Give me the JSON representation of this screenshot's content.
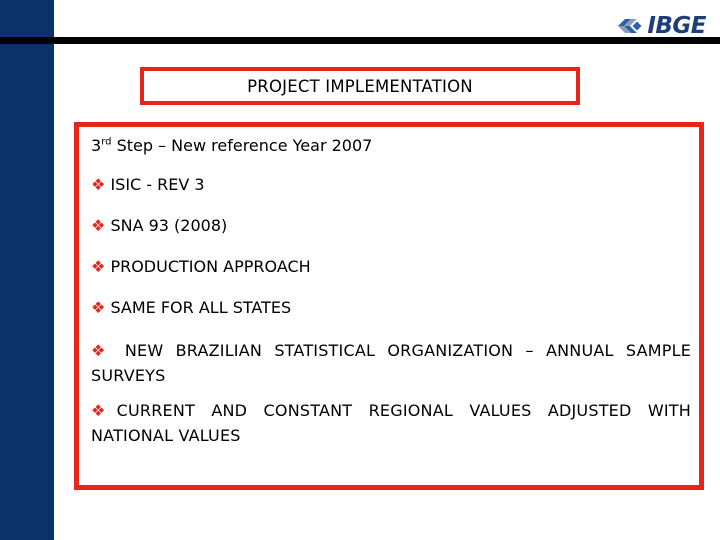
{
  "slide": {
    "logo": {
      "mark_name": "ibge-diamond-mark",
      "text": "IBGE",
      "brand_color": "#1b3f7a"
    },
    "colors": {
      "side_band": "#0c3268",
      "rule": "#000000",
      "box_border": "#e8251b",
      "bullet": "#e8251b",
      "text": "#000000"
    },
    "title": {
      "text": "PROJECT IMPLEMENTATION"
    },
    "content": {
      "heading": {
        "prefix": "3",
        "ordinal": "rd",
        "rest": " Step – New reference Year 2007"
      },
      "bullet_glyph": "❖",
      "items": [
        {
          "text": "ISIC - REV 3",
          "style": "single"
        },
        {
          "text": "SNA 93 (2008)",
          "style": "single"
        },
        {
          "text": "PRODUCTION APPROACH",
          "style": "single"
        },
        {
          "text": "SAME FOR ALL STATES",
          "style": "single"
        },
        {
          "text": "  NEW BRAZILIAN STATISTICAL ORGANIZATION – ANNUAL SAMPLE SURVEYS",
          "style": "justified"
        },
        {
          "text": "CURRENT AND CONSTANT REGIONAL VALUES ADJUSTED WITH NATIONAL VALUES",
          "style": "justified-tight"
        }
      ]
    }
  }
}
